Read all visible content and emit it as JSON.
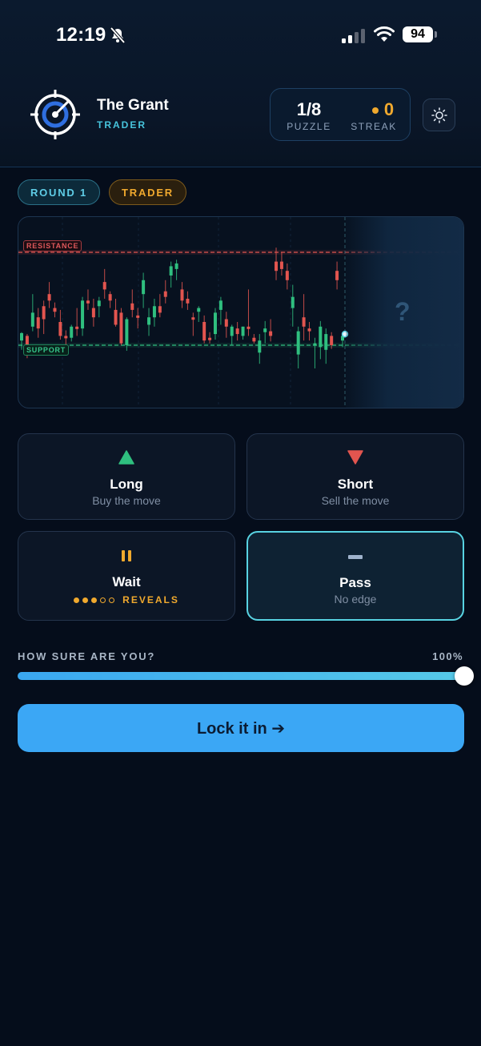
{
  "status_bar": {
    "time": "12:19",
    "battery": "94"
  },
  "header": {
    "brand_name": "The Grant",
    "brand_sub": "TRADER",
    "stats": {
      "puzzle_value": "1/8",
      "puzzle_label": "PUZZLE",
      "streak_value": "0",
      "streak_label": "STREAK"
    }
  },
  "tags": {
    "round": "ROUND 1",
    "level": "TRADER"
  },
  "chart": {
    "resistance_label": "RESISTANCE",
    "support_label": "SUPPORT",
    "unknown_mark": "?"
  },
  "chart_data": {
    "type": "candlestick",
    "resistance_level": 100,
    "support_level": 0,
    "ylim": [
      -25,
      110
    ],
    "candles": [
      {
        "o": 5,
        "h": 14,
        "l": -5,
        "c": 13,
        "dir": "up"
      },
      {
        "o": 10,
        "h": 12,
        "l": -14,
        "c": -6,
        "dir": "down"
      },
      {
        "o": 20,
        "h": 55,
        "l": 15,
        "c": 35,
        "dir": "up"
      },
      {
        "o": 30,
        "h": 40,
        "l": 8,
        "c": 18,
        "dir": "down"
      },
      {
        "o": 42,
        "h": 48,
        "l": 12,
        "c": 28,
        "dir": "down"
      },
      {
        "o": 55,
        "h": 68,
        "l": 40,
        "c": 48,
        "dir": "down"
      },
      {
        "o": 40,
        "h": 46,
        "l": 30,
        "c": 36,
        "dir": "down"
      },
      {
        "o": 25,
        "h": 38,
        "l": 6,
        "c": 10,
        "dir": "down"
      },
      {
        "o": 10,
        "h": 16,
        "l": -2,
        "c": 8,
        "dir": "down"
      },
      {
        "o": 8,
        "h": 22,
        "l": 4,
        "c": 20,
        "dir": "up"
      },
      {
        "o": 20,
        "h": 40,
        "l": 10,
        "c": 18,
        "dir": "down"
      },
      {
        "o": 18,
        "h": 52,
        "l": 10,
        "c": 48,
        "dir": "up"
      },
      {
        "o": 48,
        "h": 60,
        "l": 38,
        "c": 45,
        "dir": "down"
      },
      {
        "o": 40,
        "h": 50,
        "l": 20,
        "c": 30,
        "dir": "down"
      },
      {
        "o": 42,
        "h": 52,
        "l": 30,
        "c": 48,
        "dir": "up"
      },
      {
        "o": 60,
        "h": 82,
        "l": 50,
        "c": 68,
        "dir": "down"
      },
      {
        "o": 48,
        "h": 58,
        "l": 40,
        "c": 55,
        "dir": "down"
      },
      {
        "o": 38,
        "h": 50,
        "l": 20,
        "c": 22,
        "dir": "down"
      },
      {
        "o": 35,
        "h": 40,
        "l": 0,
        "c": 2,
        "dir": "down"
      },
      {
        "o": 0,
        "h": 30,
        "l": -6,
        "c": 28,
        "dir": "up"
      },
      {
        "o": 45,
        "h": 60,
        "l": 30,
        "c": 38,
        "dir": "down"
      },
      {
        "o": 30,
        "h": 40,
        "l": 18,
        "c": 32,
        "dir": "down"
      },
      {
        "o": 55,
        "h": 78,
        "l": 40,
        "c": 70,
        "dir": "up"
      },
      {
        "o": 22,
        "h": 40,
        "l": 10,
        "c": 30,
        "dir": "up"
      },
      {
        "o": 30,
        "h": 50,
        "l": 20,
        "c": 42,
        "dir": "up"
      },
      {
        "o": 42,
        "h": 55,
        "l": 30,
        "c": 35,
        "dir": "down"
      },
      {
        "o": 58,
        "h": 70,
        "l": 45,
        "c": 52,
        "dir": "down"
      },
      {
        "o": 75,
        "h": 90,
        "l": 62,
        "c": 85,
        "dir": "up"
      },
      {
        "o": 82,
        "h": 92,
        "l": 70,
        "c": 88,
        "dir": "up"
      },
      {
        "o": 60,
        "h": 68,
        "l": 40,
        "c": 48,
        "dir": "down"
      },
      {
        "o": 50,
        "h": 58,
        "l": 38,
        "c": 45,
        "dir": "down"
      },
      {
        "o": 30,
        "h": 35,
        "l": 10,
        "c": 30,
        "dir": "down"
      },
      {
        "o": 36,
        "h": 42,
        "l": 25,
        "c": 40,
        "dir": "up"
      },
      {
        "o": 25,
        "h": 32,
        "l": 2,
        "c": 5,
        "dir": "down"
      },
      {
        "o": 8,
        "h": 14,
        "l": 2,
        "c": 6,
        "dir": "down"
      },
      {
        "o": 12,
        "h": 40,
        "l": 6,
        "c": 35,
        "dir": "up"
      },
      {
        "o": 38,
        "h": 52,
        "l": 22,
        "c": 48,
        "dir": "up"
      },
      {
        "o": 28,
        "h": 36,
        "l": 8,
        "c": 20,
        "dir": "down"
      },
      {
        "o": 10,
        "h": 22,
        "l": 0,
        "c": 20,
        "dir": "up"
      },
      {
        "o": 18,
        "h": 25,
        "l": 5,
        "c": 12,
        "dir": "down"
      },
      {
        "o": 10,
        "h": 20,
        "l": 6,
        "c": 20,
        "dir": "up"
      },
      {
        "o": 20,
        "h": 60,
        "l": 10,
        "c": 18,
        "dir": "down"
      },
      {
        "o": 4,
        "h": 12,
        "l": 2,
        "c": 8,
        "dir": "down"
      },
      {
        "o": 5,
        "h": 12,
        "l": -20,
        "c": -8,
        "dir": "up"
      },
      {
        "o": 14,
        "h": 26,
        "l": 2,
        "c": 18,
        "dir": "up"
      },
      {
        "o": 10,
        "h": 28,
        "l": 4,
        "c": 15,
        "dir": "down"
      },
      {
        "o": 80,
        "h": 105,
        "l": 70,
        "c": 90,
        "dir": "down"
      },
      {
        "o": 90,
        "h": 100,
        "l": 75,
        "c": 82,
        "dir": "down"
      },
      {
        "o": 80,
        "h": 88,
        "l": 60,
        "c": 70,
        "dir": "down"
      },
      {
        "o": 40,
        "h": 65,
        "l": 20,
        "c": 52,
        "dir": "up"
      },
      {
        "o": 15,
        "h": 20,
        "l": -25,
        "c": -10,
        "dir": "up"
      },
      {
        "o": 30,
        "h": 55,
        "l": 5,
        "c": 20,
        "dir": "down"
      },
      {
        "o": 15,
        "h": 25,
        "l": 5,
        "c": 18,
        "dir": "down"
      },
      {
        "o": 0,
        "h": 8,
        "l": -25,
        "c": 2,
        "dir": "up"
      },
      {
        "o": 20,
        "h": 26,
        "l": -15,
        "c": -2,
        "dir": "up"
      },
      {
        "o": 12,
        "h": 18,
        "l": -20,
        "c": -5,
        "dir": "up"
      },
      {
        "o": 10,
        "h": 14,
        "l": -4,
        "c": 0,
        "dir": "down"
      },
      {
        "o": 80,
        "h": 90,
        "l": 60,
        "c": 70,
        "dir": "down"
      },
      {
        "o": 5,
        "h": 12,
        "l": -2,
        "c": 10,
        "dir": "up"
      }
    ],
    "current_price": 12
  },
  "actions": {
    "long": {
      "title": "Long",
      "sub": "Buy the move"
    },
    "short": {
      "title": "Short",
      "sub": "Sell the move"
    },
    "wait": {
      "title": "Wait",
      "reveals_label": "REVEALS",
      "reveals_total": 5,
      "reveals_used": 3
    },
    "pass": {
      "title": "Pass",
      "sub": "No edge",
      "selected": true
    }
  },
  "confidence": {
    "label": "HOW SURE ARE YOU?",
    "value_text": "100%",
    "value": 1.0
  },
  "submit": {
    "label": "Lock it in ➔"
  },
  "colors": {
    "up": "#2fbf7f",
    "down": "#e2554f",
    "accent": "#3ba7f5",
    "streak": "#f0a92e"
  }
}
